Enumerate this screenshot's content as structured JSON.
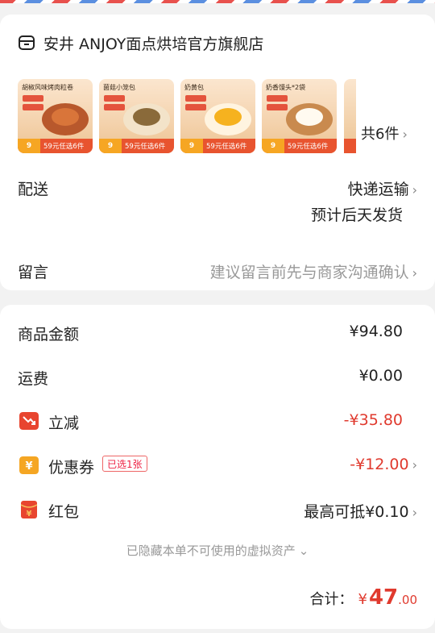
{
  "shop": {
    "name": "安井 ANJOY面点烘培官方旗舰店"
  },
  "products": [
    {
      "title": "胡椒风味烤肉粒卷",
      "price": "9",
      "promo": "59元任选6件"
    },
    {
      "title": "菌菇小笼包",
      "price": "9",
      "promo": "59元任选6件"
    },
    {
      "title": "奶黄包",
      "price": "9",
      "promo": "59元任选6件"
    },
    {
      "title": "奶香馒头*2袋",
      "price": "9",
      "promo": "59元任选6件"
    }
  ],
  "item_count": "共6件",
  "delivery": {
    "label": "配送",
    "method": "快递运输",
    "eta": "预计后天发货"
  },
  "message": {
    "label": "留言",
    "placeholder": "建议留言前先与商家沟通确认"
  },
  "summary": {
    "goods_label": "商品金额",
    "goods_value": "¥94.80",
    "shipping_label": "运费",
    "shipping_value": "¥0.00",
    "discount_label": "立减",
    "discount_value": "-¥35.80",
    "coupon_label": "优惠券",
    "coupon_badge": "已选1张",
    "coupon_value": "-¥12.00",
    "redpacket_label": "红包",
    "redpacket_value": "最高可抵¥0.10",
    "hidden_assets": "已隐藏本单不可使用的虚拟资产"
  },
  "total": {
    "label": "合计：",
    "currency": "¥",
    "integer": "47",
    "decimal": ".00"
  },
  "colors": {
    "accent_red": "#e03a2e",
    "coupon_orange": "#f5a623",
    "discount_red": "#e8452f"
  }
}
